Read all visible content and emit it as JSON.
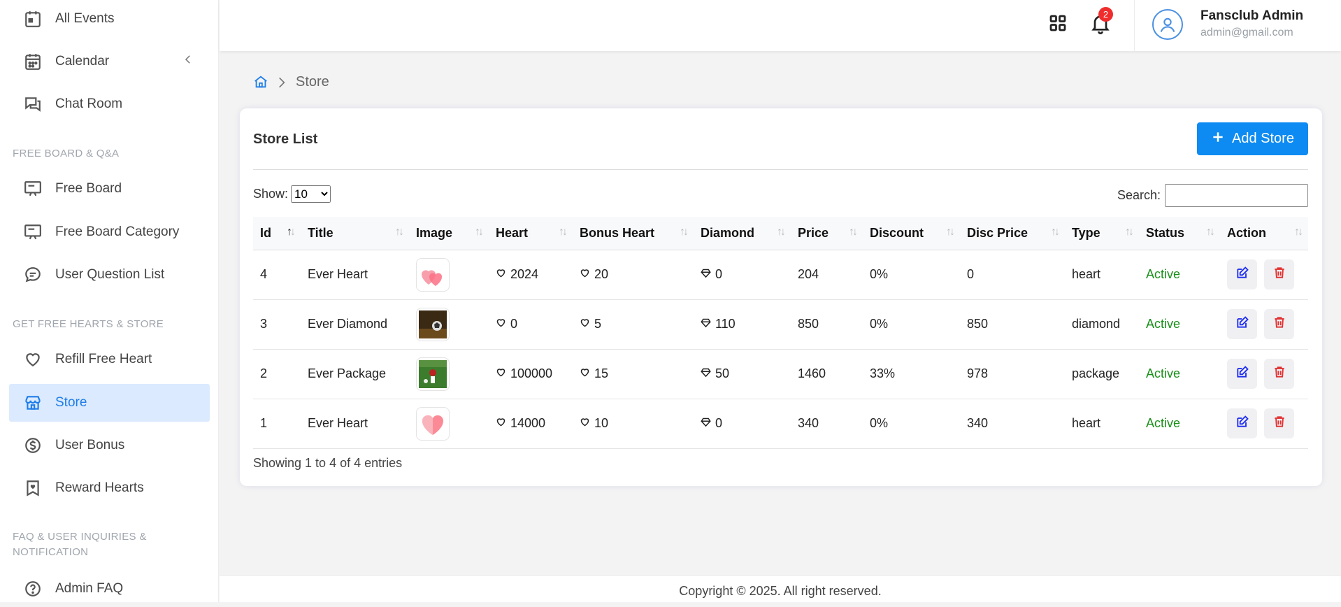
{
  "sidebar": {
    "items": [
      {
        "label": "All Events"
      },
      {
        "label": "Calendar"
      },
      {
        "label": "Chat Room"
      },
      {
        "label": "Free Board"
      },
      {
        "label": "Free Board Category"
      },
      {
        "label": "User Question List"
      },
      {
        "label": "Refill Free Heart"
      },
      {
        "label": "Store"
      },
      {
        "label": "User Bonus"
      },
      {
        "label": "Reward Hearts"
      },
      {
        "label": "Admin FAQ"
      }
    ],
    "sections": [
      {
        "label": "FREE BOARD & Q&A"
      },
      {
        "label": "GET FREE HEARTS & STORE"
      },
      {
        "label": "FAQ & USER INQUIRIES & NOTIFICATION"
      }
    ]
  },
  "header": {
    "notification_count": "2",
    "user_name": "Fansclub Admin",
    "user_email": "admin@gmail.com"
  },
  "breadcrumb": {
    "current": "Store"
  },
  "card": {
    "title": "Store List",
    "add_label": "Add Store",
    "show_label": "Show:",
    "show_value": "10",
    "search_label": "Search:",
    "info": "Showing 1 to 4 of 4 entries"
  },
  "table": {
    "columns": [
      "Id",
      "Title",
      "Image",
      "Heart",
      "Bonus Heart",
      "Diamond",
      "Price",
      "Discount",
      "Disc Price",
      "Type",
      "Status",
      "Action"
    ],
    "rows": [
      {
        "id": "4",
        "title": "Ever Heart",
        "image": "hearts-icon",
        "heart": "2024",
        "bonus": "20",
        "diamond": "0",
        "price": "204",
        "discount": "0%",
        "disc_price": "0",
        "type": "heart",
        "status": "Active"
      },
      {
        "id": "3",
        "title": "Ever Diamond",
        "image": "soccer-photo",
        "heart": "0",
        "bonus": "5",
        "diamond": "110",
        "price": "850",
        "discount": "0%",
        "disc_price": "850",
        "type": "diamond",
        "status": "Active"
      },
      {
        "id": "2",
        "title": "Ever Package",
        "image": "soccer-field-photo",
        "heart": "100000",
        "bonus": "15",
        "diamond": "50",
        "price": "1460",
        "discount": "33%",
        "disc_price": "978",
        "type": "package",
        "status": "Active"
      },
      {
        "id": "1",
        "title": "Ever Heart",
        "image": "heart-icon",
        "heart": "14000",
        "bonus": "10",
        "diamond": "0",
        "price": "340",
        "discount": "0%",
        "disc_price": "340",
        "type": "heart",
        "status": "Active"
      }
    ]
  },
  "footer": {
    "text": "Copyright © 2025. All right reserved."
  },
  "colors": {
    "accent": "#0d8bf2",
    "active_status": "#1a8f1a",
    "delete": "#e03131",
    "edit": "#1d2cf0"
  }
}
